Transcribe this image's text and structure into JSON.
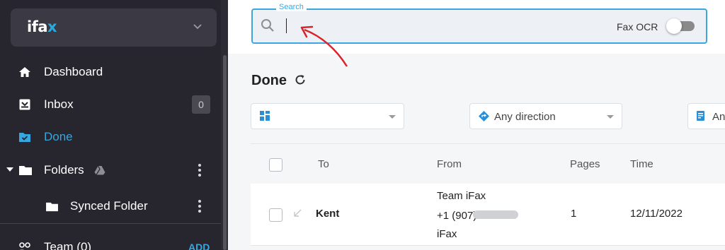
{
  "brand": {
    "logo_text": "ifa",
    "logo_accent": "x"
  },
  "sidebar": {
    "items": [
      {
        "label": "Dashboard",
        "icon": "home-icon"
      },
      {
        "label": "Inbox",
        "icon": "inbox-icon",
        "badge": "0"
      },
      {
        "label": "Done",
        "icon": "folder-check-icon",
        "active": true
      },
      {
        "label": "Folders",
        "icon": "folder-icon"
      },
      {
        "label": "Synced Folder",
        "icon": "folder-icon"
      },
      {
        "label": "Team (0)",
        "icon": "team-icon",
        "action": "ADD"
      }
    ]
  },
  "search": {
    "legend": "Search",
    "value": "",
    "ocr_label": "Fax OCR",
    "ocr_enabled": false
  },
  "page": {
    "title": "Done"
  },
  "filters": [
    {
      "icon": "grid-icon",
      "value": ""
    },
    {
      "icon": "direction-icon",
      "value": "Any direction"
    },
    {
      "icon": "status-icon",
      "value": "An"
    }
  ],
  "table": {
    "columns": [
      "To",
      "From",
      "Pages",
      "Time"
    ],
    "rows": [
      {
        "to": "Kent",
        "from_name": "Team iFax",
        "from_number": "+1 (907)",
        "from_company": "iFax",
        "pages": "1",
        "time": "12/11/2022"
      }
    ]
  },
  "colors": {
    "accent": "#35a8e0",
    "sidebar_bg": "#27252e",
    "annotation": "#d9242b"
  }
}
